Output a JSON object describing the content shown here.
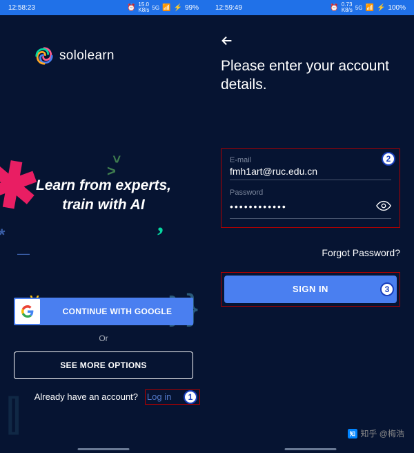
{
  "left": {
    "status": {
      "time": "12:58:23",
      "speed_up": "15.0",
      "speed_dn": "K8/s",
      "signal": "5G",
      "battery": "99%"
    },
    "brand": "sololearn",
    "hero_line1": "Learn from experts,",
    "hero_line2": "train with AI",
    "google_btn": "CONTINUE WITH GOOGLE",
    "or": "Or",
    "more_btn": "SEE MORE OPTIONS",
    "login_prompt": "Already have an account?",
    "login_link": "Log in",
    "badge1": "1"
  },
  "right": {
    "status": {
      "time": "12:59:49",
      "speed_up": "0.73",
      "speed_dn": "K8/s",
      "signal": "5G",
      "battery": "100%"
    },
    "title": "Please enter your account details.",
    "email_label": "E-mail",
    "email_value": "fmh1art@ruc.edu.cn",
    "password_label": "Password",
    "password_value": "••••••••••••",
    "forgot": "Forgot Password?",
    "signin": "SIGN IN",
    "badge2": "2",
    "badge3": "3"
  },
  "watermark": "知乎 @梅浩"
}
